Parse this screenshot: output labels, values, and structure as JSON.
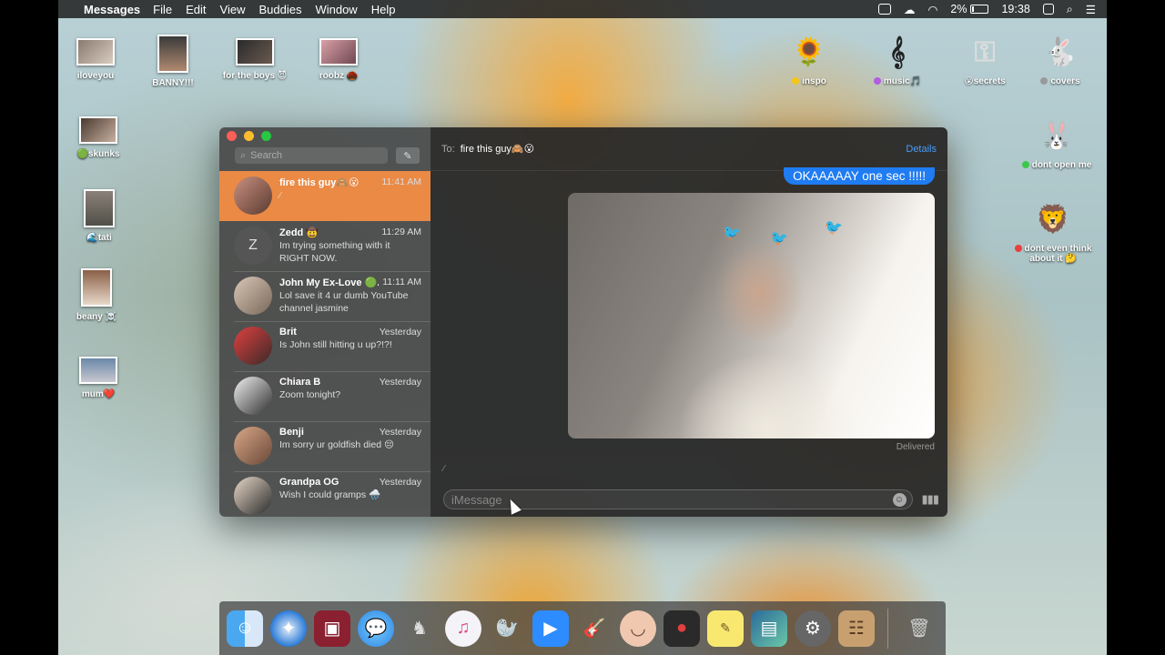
{
  "menubar": {
    "app_name": "Messages",
    "items": [
      "File",
      "Edit",
      "View",
      "Buddies",
      "Window",
      "Help"
    ],
    "battery": "2%",
    "clock": "19:38"
  },
  "desktop_icons": [
    {
      "label": "iloveyou"
    },
    {
      "label": "BANNY!!!"
    },
    {
      "label": "for the boys 😈"
    },
    {
      "label": "roobz 🌰"
    },
    {
      "label": "🟢skunks"
    },
    {
      "label": "🌊tati"
    },
    {
      "label": "beany ☠️"
    },
    {
      "label": "mum❤️"
    },
    {
      "label": "inspo",
      "dot": "#f5c518"
    },
    {
      "label": "music🎵",
      "dot": "#b25ce0"
    },
    {
      "label": "😮secrets"
    },
    {
      "label": "covers",
      "dot": "#999999"
    },
    {
      "label": "dont open me",
      "dot": "#3cc84a"
    },
    {
      "label": "dont even think about it 🤔",
      "dot": "#e84040"
    }
  ],
  "sidebar": {
    "search_placeholder": "Search",
    "conversations": [
      {
        "name": "fire this guy🙈😮",
        "time": "11:41 AM",
        "preview": "",
        "initial": ""
      },
      {
        "name": "Zedd 🤠",
        "time": "11:29 AM",
        "preview": "Im trying something with it RIGHT NOW.",
        "initial": "Z"
      },
      {
        "name": "John My Ex-Love 🟢...",
        "time": "11:11 AM",
        "preview": "Lol save it 4 ur dumb YouTube channel jasmine",
        "initial": ""
      },
      {
        "name": "Brit",
        "time": "Yesterday",
        "preview": "Is John still hitting u up?!?!",
        "initial": ""
      },
      {
        "name": "Chiara B",
        "time": "Yesterday",
        "preview": "Zoom tonight?",
        "initial": ""
      },
      {
        "name": "Benji",
        "time": "Yesterday",
        "preview": "Im sorry ur goldfish died 😔",
        "initial": ""
      },
      {
        "name": "Grandpa OG",
        "time": "Yesterday",
        "preview": "Wish I could gramps 🌧️",
        "initial": ""
      }
    ]
  },
  "chat": {
    "to_label": "To:",
    "recipient": "fire this guy🙈😮",
    "details_label": "Details",
    "last_bubble": "OKAAAAAY one sec !!!!!",
    "status": "Delivered",
    "input_placeholder": "iMessage"
  },
  "colors": {
    "selected_row": "#ea8a45",
    "bubble_blue": "#1f7cf2",
    "link_blue": "#4a9cf5"
  },
  "dock": {
    "icons": [
      "finder-icon",
      "safari-icon",
      "photo-booth-icon",
      "messages-icon",
      "ghost-icon",
      "itunes-icon",
      "walrus-icon",
      "zoom-icon",
      "garageband-icon",
      "face-icon",
      "photo-slideshow-icon",
      "stickies-icon",
      "preview-icon",
      "system-preferences-icon",
      "contacts-icon",
      "trash-icon"
    ]
  }
}
